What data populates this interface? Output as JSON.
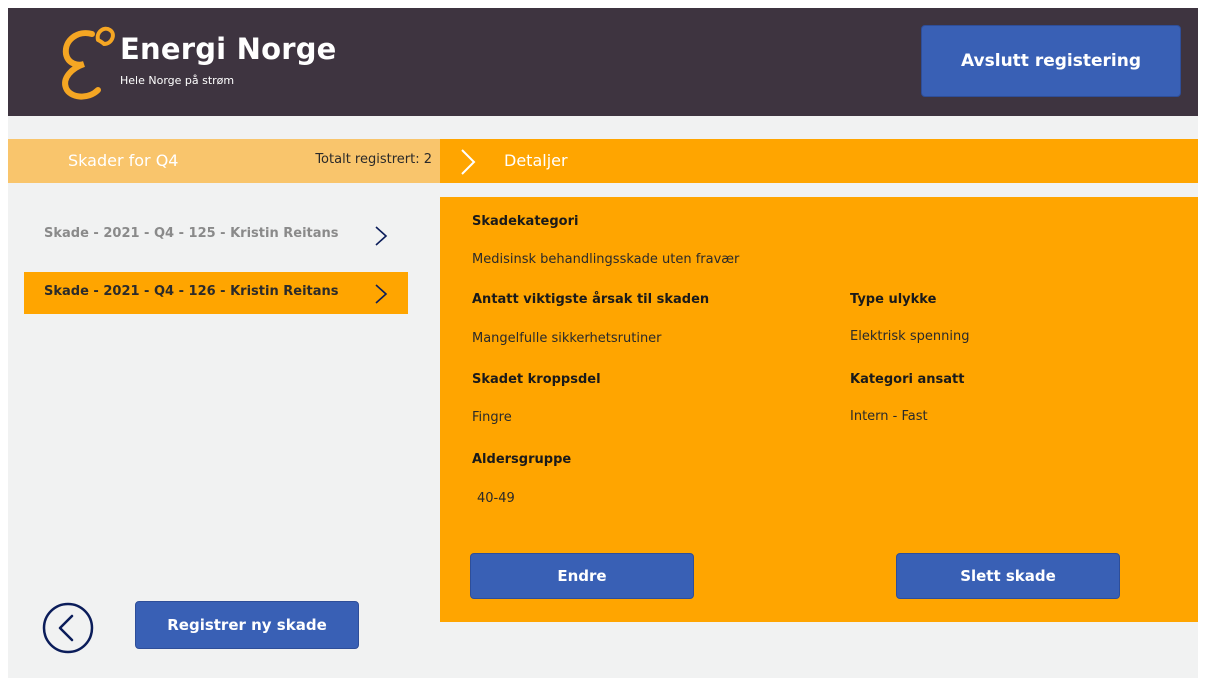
{
  "header": {
    "logo_title": "Energi Norge",
    "logo_subtitle": "Hele Norge på strøm",
    "exit_button": "Avslutt registering"
  },
  "list_panel": {
    "title": "Skader for Q4",
    "total": "Totalt registrert: 2",
    "items": [
      {
        "label": "Skade - 2021 - Q4 - 125 - Kristin Reitans",
        "selected": false
      },
      {
        "label": "Skade - 2021 - Q4 - 126 - Kristin Reitans",
        "selected": true
      }
    ]
  },
  "details": {
    "title": "Detaljer",
    "fields": {
      "skadekategori": {
        "label": "Skadekategori",
        "value": "Medisinsk behandlingsskade uten fravær"
      },
      "arsak": {
        "label": "Antatt viktigste årsak til skaden",
        "value": "Mangelfulle sikkerhetsrutiner"
      },
      "type_ulykke": {
        "label": "Type ulykke",
        "value": "Elektrisk spenning"
      },
      "kroppsdel": {
        "label": "Skadet kroppsdel",
        "value": "Fingre"
      },
      "kategori_ansatt": {
        "label": "Kategori ansatt",
        "value": "Intern - Fast"
      },
      "aldersgruppe": {
        "label": "Aldersgruppe",
        "value": "40-49"
      }
    },
    "edit_button": "Endre",
    "delete_button": "Slett skade"
  },
  "footer": {
    "new_button": "Registrer ny skade"
  },
  "colors": {
    "header_bg": "#3e3440",
    "accent_orange": "#ffa500",
    "light_orange": "#f9c56c",
    "button_blue": "#3960b5",
    "navy": "#0b1d5a"
  },
  "icons": {
    "logo": "energi-norge-logo-icon",
    "chevron": "chevron-right-icon",
    "back": "back-arrow-circle-icon"
  }
}
